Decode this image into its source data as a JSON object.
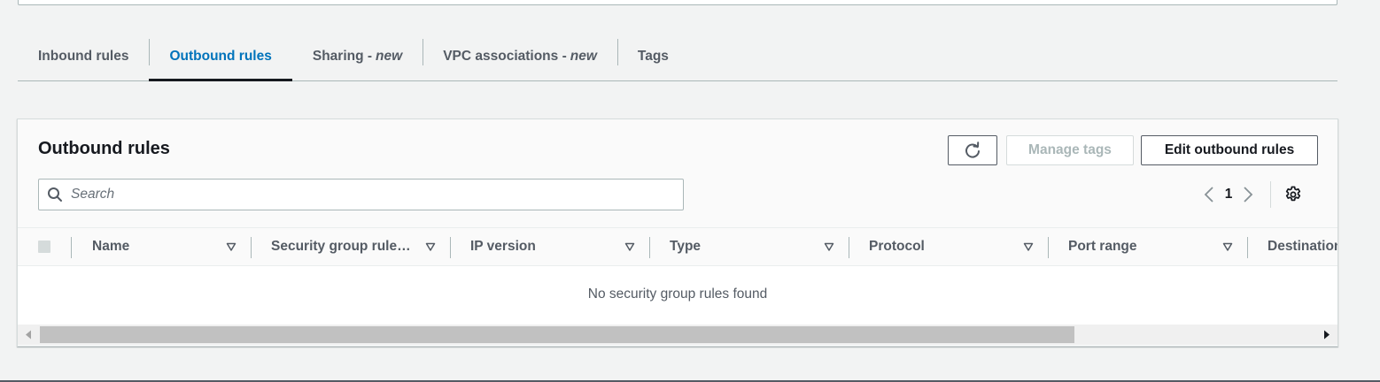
{
  "tabs": [
    {
      "label": "Inbound rules",
      "suffix": ""
    },
    {
      "label": "Outbound rules",
      "suffix": ""
    },
    {
      "label": "Sharing - ",
      "suffix": "new"
    },
    {
      "label": "VPC associations - ",
      "suffix": "new"
    },
    {
      "label": "Tags",
      "suffix": ""
    }
  ],
  "active_tab": "Outbound rules",
  "panel": {
    "title": "Outbound rules",
    "buttons": {
      "refresh_icon": "refresh-icon",
      "manage_tags": "Manage tags",
      "edit_outbound_rules": "Edit outbound rules"
    },
    "search": {
      "placeholder": "Search",
      "value": ""
    },
    "pagination": {
      "current_page": "1"
    }
  },
  "table": {
    "columns": [
      "Name",
      "Security group rule…",
      "IP version",
      "Type",
      "Protocol",
      "Port range",
      "Destination"
    ],
    "empty_message": "No security group rules found"
  },
  "colors": {
    "accent": "#0073bb",
    "text": "#16191f",
    "secondary_text": "#545b64",
    "border": "#aab7b8",
    "background": "#f2f3f3",
    "disabled": "#aab7b8"
  }
}
